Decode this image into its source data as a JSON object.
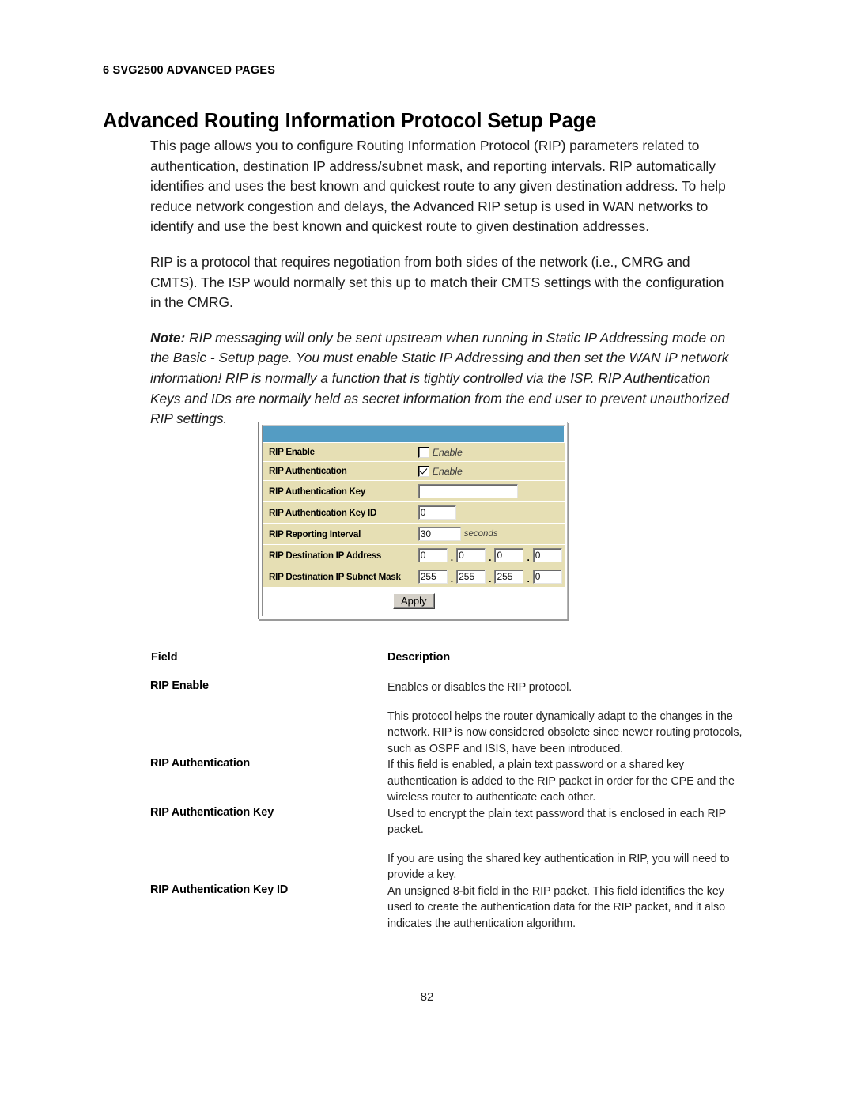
{
  "document": {
    "running_head": "6 SVG2500 ADVANCED PAGES",
    "title": "Advanced Routing Information Protocol Setup Page",
    "page_number": "82"
  },
  "body": {
    "paragraph_1": "This page allows you to configure Routing Information Protocol (RIP) parameters related to authentication, destination IP address/subnet mask, and reporting intervals. RIP automatically identifies and uses the best known and quickest route to any given destination address. To help reduce network congestion and delays, the Advanced RIP setup is used in WAN networks to identify and use the best known and quickest route to given destination addresses.",
    "paragraph_2": "RIP is a protocol that requires negotiation from both sides of the network (i.e., CMRG and CMTS). The ISP would normally set this up to match their CMTS settings with the configuration in the CMRG.",
    "note_label": "Note:",
    "note_text": " RIP messaging will only be sent upstream when running in Static IP Addressing mode on the Basic - Setup page. You must enable Static IP Addressing and then set the WAN IP network information! RIP is normally a function that is tightly controlled via the ISP. RIP Authentication Keys and IDs are normally held as secret information from the end user to prevent unauthorized RIP settings."
  },
  "screenshot": {
    "colors": {
      "header_bar": "#549cc3",
      "label_cell": "#e6dfb4",
      "button_face": "#d4d0c8"
    },
    "rows": {
      "rip_enable": {
        "label": "RIP Enable",
        "checkbox_label": "Enable",
        "checked": false
      },
      "rip_authentication": {
        "label": "RIP Authentication",
        "checkbox_label": "Enable",
        "checked": true
      },
      "rip_authentication_key": {
        "label": "RIP Authentication Key",
        "value": ""
      },
      "rip_authentication_key_id": {
        "label": "RIP Authentication Key ID",
        "value": "0"
      },
      "rip_reporting_interval": {
        "label": "RIP Reporting Interval",
        "value": "30",
        "units": "seconds"
      },
      "rip_destination_ip_address": {
        "label": "RIP Destination IP Address",
        "octets": [
          "0",
          "0",
          "0",
          "0"
        ]
      },
      "rip_destination_ip_subnet_mask": {
        "label": "RIP Destination IP Subnet Mask",
        "octets": [
          "255",
          "255",
          "255",
          "0"
        ]
      }
    },
    "apply_button": "Apply"
  },
  "definition_table": {
    "header_field": "Field",
    "header_description": "Description",
    "rows": [
      {
        "field": "RIP Enable",
        "paragraphs": [
          "Enables or disables the RIP protocol.",
          "This protocol helps the router dynamically adapt to the changes in the network. RIP is now considered obsolete since newer routing protocols, such as OSPF and ISIS, have been introduced."
        ]
      },
      {
        "field": "RIP Authentication",
        "paragraphs": [
          "If this field is enabled, a plain text password or a shared key authentication is added to the RIP packet in order for the CPE and the wireless router to authenticate each other."
        ]
      },
      {
        "field": "RIP Authentication Key",
        "paragraphs": [
          "Used to encrypt the plain text password that is enclosed in each RIP packet.",
          "If you are using the shared key authentication in RIP, you will need to provide a key."
        ]
      },
      {
        "field": "RIP Authentication Key ID",
        "paragraphs": [
          "An unsigned 8-bit field in the RIP packet. This field identifies the key used to create the authentication data for the RIP packet, and it also indicates the authentication algorithm."
        ]
      }
    ]
  }
}
